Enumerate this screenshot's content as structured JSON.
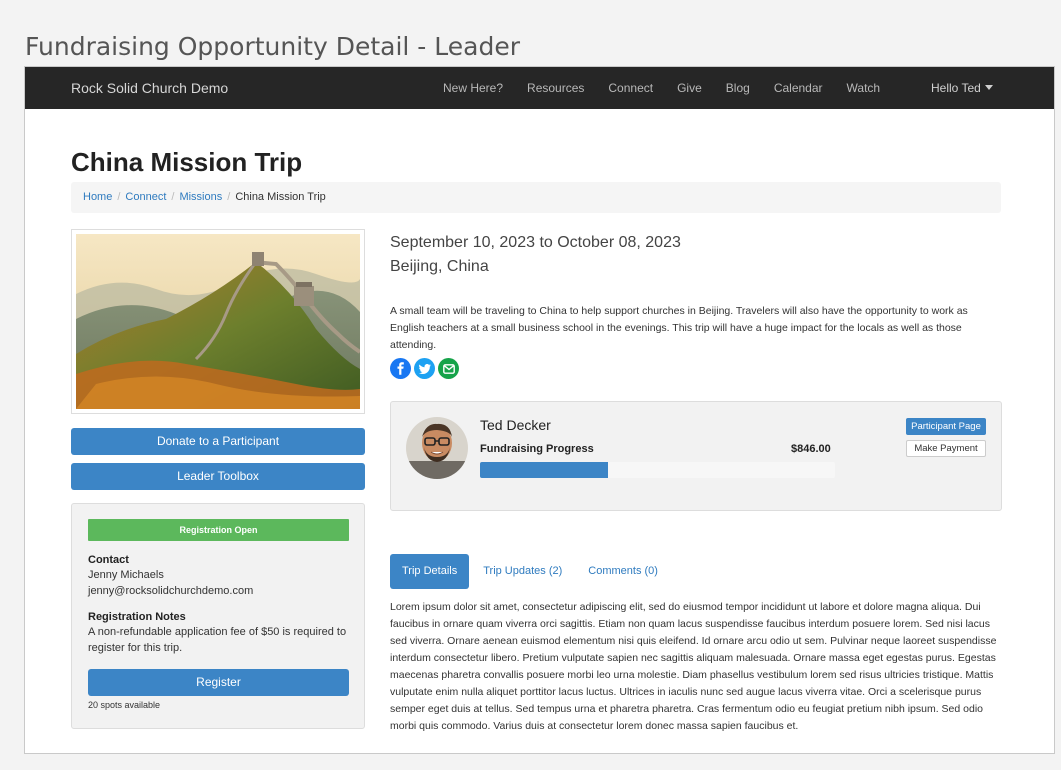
{
  "caption": "Fundraising Opportunity Detail - Leader",
  "nav": {
    "brand": "Rock Solid Church Demo",
    "links": [
      "New Here?",
      "Resources",
      "Connect",
      "Give",
      "Blog",
      "Calendar",
      "Watch"
    ],
    "user": "Hello Ted"
  },
  "page": {
    "title": "China Mission Trip",
    "breadcrumb": [
      "Home",
      "Connect",
      "Missions",
      "China Mission Trip"
    ]
  },
  "sidebar": {
    "donate_label": "Donate to a Participant",
    "toolbox_label": "Leader Toolbox",
    "status_badge": "Registration Open",
    "contact_label": "Contact",
    "contact_name": "Jenny Michaels",
    "contact_email": "jenny@rocksolidchurchdemo.com",
    "notes_label": "Registration Notes",
    "notes_text": "A non-refundable application fee of $50 is required to register for this trip.",
    "register_label": "Register",
    "spots_text": "20 spots available"
  },
  "trip": {
    "dates": "September 10, 2023 to October 08, 2023",
    "location": "Beijing, China",
    "description": "A small team will be traveling to China to help support churches in Beijing. Travelers will also have the opportunity to work as English teachers at a small business school in the evenings. This trip will have a huge impact for the locals as well as those attending."
  },
  "share_icons": [
    "facebook-icon",
    "twitter-icon",
    "email-icon"
  ],
  "colors": {
    "accent": "#3c85c6",
    "success": "#5cb85c",
    "facebook": "#1877f2",
    "twitter": "#1da1f2",
    "email": "#16a34a"
  },
  "participant": {
    "name": "Ted Decker",
    "progress_label": "Fundraising Progress",
    "amount": "$846.00",
    "progress_fraction": 0.36,
    "page_button": "Participant Page",
    "payment_button": "Make Payment"
  },
  "tabs": [
    "Trip Details",
    "Trip Updates (2)",
    "Comments (0)"
  ],
  "details_text": "Lorem ipsum dolor sit amet, consectetur adipiscing elit, sed do eiusmod tempor incididunt ut labore et dolore magna aliqua. Dui faucibus in ornare quam viverra orci sagittis. Etiam non quam lacus suspendisse faucibus interdum posuere lorem. Sed nisi lacus sed viverra. Ornare aenean euismod elementum nisi quis eleifend. Id ornare arcu odio ut sem. Pulvinar neque laoreet suspendisse interdum consectetur libero. Pretium vulputate sapien nec sagittis aliquam malesuada. Ornare massa eget egestas purus. Egestas maecenas pharetra convallis posuere morbi leo urna molestie. Diam phasellus vestibulum lorem sed risus ultricies tristique. Mattis vulputate enim nulla aliquet porttitor lacus luctus. Ultrices in iaculis nunc sed augue lacus viverra vitae. Orci a scelerisque purus semper eget duis at tellus. Sed tempus urna et pharetra pharetra. Cras fermentum odio eu feugiat pretium nibh ipsum. Sed odio morbi quis commodo. Varius duis at consectetur lorem donec massa sapien faucibus et."
}
